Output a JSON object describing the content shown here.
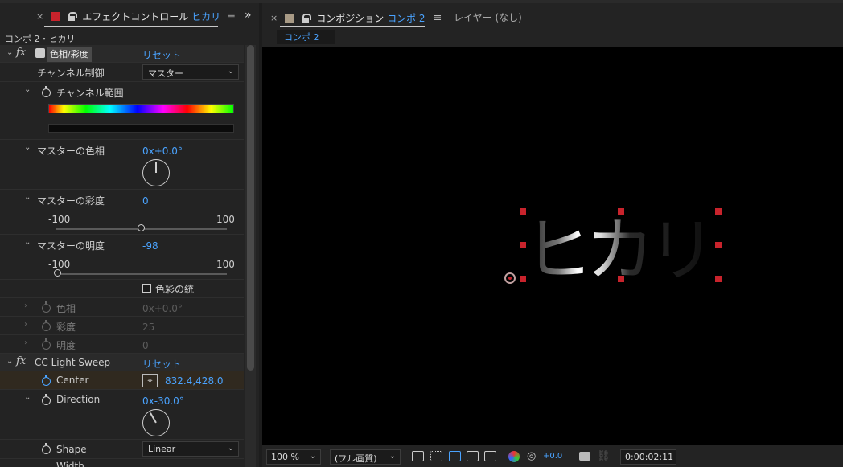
{
  "effect_panel": {
    "tab_close": "×",
    "tab_title": "エフェクトコントロール",
    "tab_title_accent": "ヒカリ",
    "menu_icon": "≡",
    "collapse_icon": "»",
    "layer_path": "コンポ 2・ヒカリ",
    "effects": [
      {
        "name": "色相/彩度",
        "reset": "リセット",
        "channel_control_label": "チャンネル制御",
        "channel_control_value": "マスター",
        "channel_range_label": "チャンネル範囲",
        "master_hue_label": "マスターの色相",
        "master_hue_value": "0x+0.0°",
        "master_hue_degrees": 0,
        "master_saturation_label": "マスターの彩度",
        "master_saturation_value": "0",
        "master_saturation_fraction": 0.5,
        "master_lightness_label": "マスターの明度",
        "master_lightness_value": "-98",
        "master_lightness_fraction": 0.01,
        "slider_min": "-100",
        "slider_max": "100",
        "colorize_label": "色彩の統一",
        "colorize_checked": false,
        "colorize_hue_label": "色相",
        "colorize_hue_value": "0x+0.0°",
        "colorize_saturation_label": "彩度",
        "colorize_saturation_value": "25",
        "colorize_lightness_label": "明度",
        "colorize_lightness_value": "0"
      },
      {
        "name": "CC Light Sweep",
        "reset": "リセット",
        "center_label": "Center",
        "center_value": "832.4,428.0",
        "direction_label": "Direction",
        "direction_value": "0x-30.0°",
        "direction_degrees": -30,
        "shape_label": "Shape",
        "shape_value": "Linear",
        "width_label": "Width"
      }
    ]
  },
  "composition_panel": {
    "tab_close": "×",
    "tab_title": "コンポジション",
    "tab_title_accent": "コンポ 2",
    "menu_icon": "≡",
    "layer_tab": "レイヤー (なし)",
    "comp_subtab": "コンポ 2",
    "canvas_text": "ヒカリ",
    "footer": {
      "zoom": "100 %",
      "resolution": "(フル画質)",
      "exposure": "+0.0",
      "timecode": "0:00:02:11"
    }
  },
  "colors": {
    "accent": "#4aa3ff",
    "effect_label_color": "#c8232c",
    "comp_label_color": "#a89a85",
    "handle": "#c8232c"
  }
}
